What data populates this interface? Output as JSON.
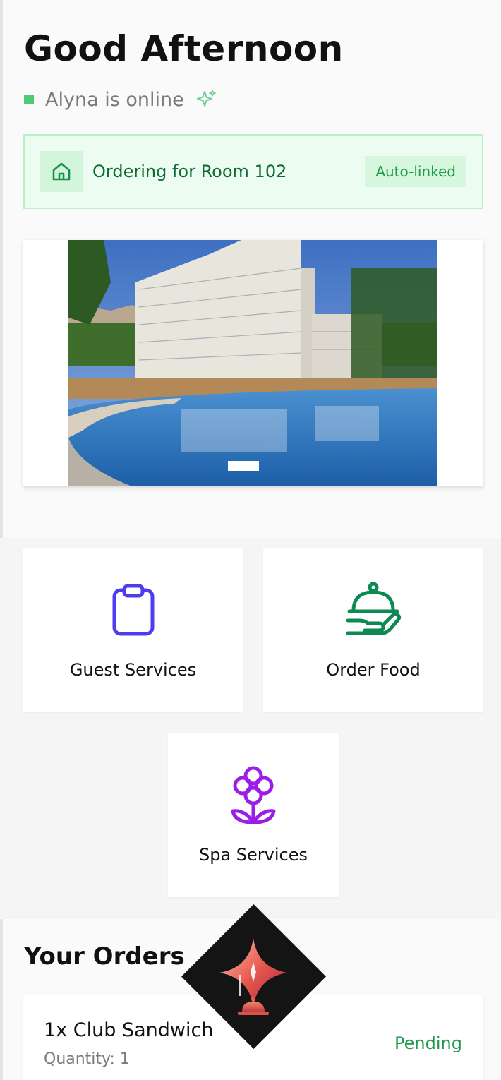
{
  "header": {
    "greeting": "Good Afternoon",
    "assistant_status": "Alyna is online"
  },
  "room_banner": {
    "label": "Ordering for Room 102",
    "badge": "Auto-linked",
    "icon": "home-icon"
  },
  "hero": {
    "image_subject": "hotel-pool-photo",
    "carousel_active_index": 1,
    "carousel_count": 1
  },
  "services": [
    {
      "label": "Guest Services",
      "icon": "clipboard-icon",
      "color": "#4f3cf0"
    },
    {
      "label": "Order Food",
      "icon": "food-cloche-icon",
      "color": "#0d8a52"
    },
    {
      "label": "Spa Services",
      "icon": "flower-icon",
      "color": "#9b1ee8"
    }
  ],
  "orders": {
    "title": "Your Orders",
    "items": [
      {
        "name": "1x Club Sandwich",
        "quantity": "Quantity: 1",
        "status": "Pending"
      }
    ]
  },
  "colors": {
    "online": "#4ecb71",
    "banner_bg": "#edfcf0",
    "banner_text": "#0f6b36",
    "status_pending": "#1f9a4d"
  },
  "fab": {
    "icon": "concierge-bell-sparkle-icon"
  }
}
